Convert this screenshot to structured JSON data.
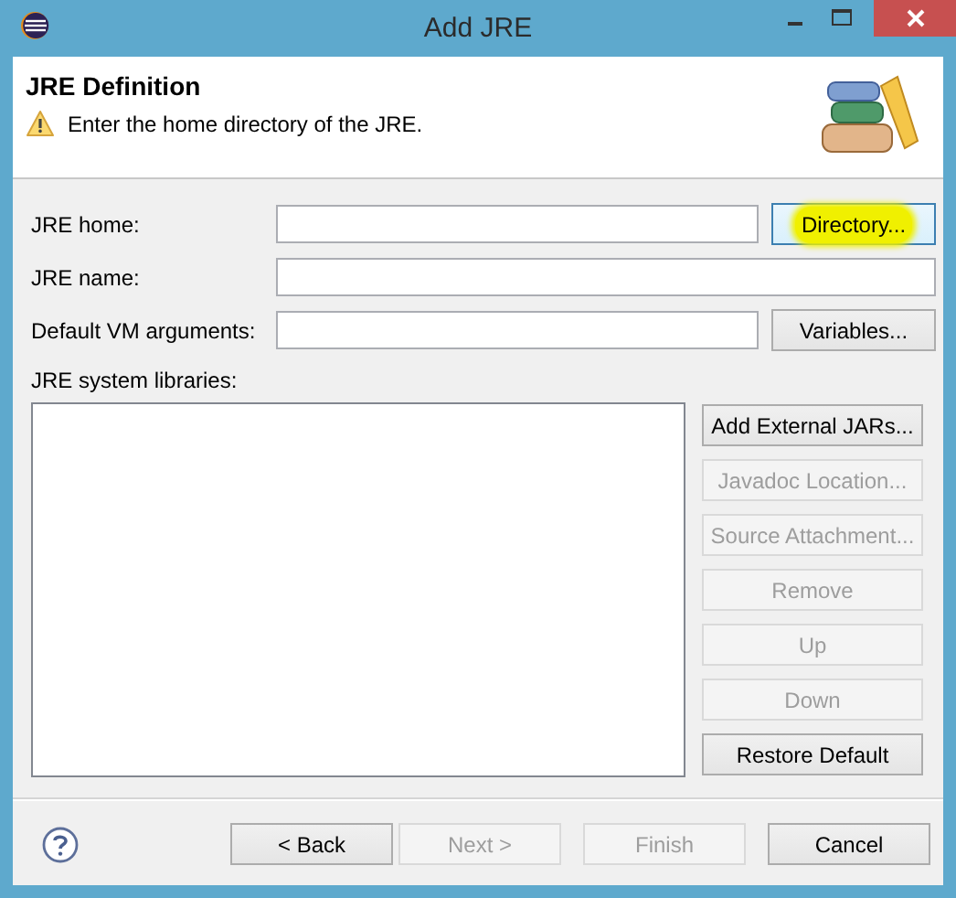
{
  "window": {
    "title": "Add JRE"
  },
  "header": {
    "title": "JRE Definition",
    "message": "Enter the home directory of the JRE."
  },
  "fields": [
    {
      "label": "JRE home:",
      "button": {
        "label": "Directory...",
        "disabled": false,
        "focused": true,
        "highlighted": true
      }
    },
    {
      "label": "JRE name:"
    },
    {
      "label": "Default VM arguments:",
      "button": {
        "label": "Variables...",
        "disabled": false,
        "focused": false,
        "highlighted": false
      }
    }
  ],
  "libraries": {
    "label": "JRE system libraries:",
    "buttons": [
      {
        "label": "Add External JARs...",
        "disabled": false
      },
      {
        "label": "Javadoc Location...",
        "disabled": true
      },
      {
        "label": "Source Attachment...",
        "disabled": true
      },
      {
        "label": "Remove",
        "disabled": true
      },
      {
        "label": "Up",
        "disabled": true
      },
      {
        "label": "Down",
        "disabled": true
      },
      {
        "label": "Restore Default",
        "disabled": false
      }
    ]
  },
  "footer": {
    "buttons": [
      {
        "label": "< Back",
        "disabled": false
      },
      {
        "label": "Next >",
        "disabled": true
      },
      {
        "label": "Finish",
        "disabled": true
      },
      {
        "label": "Cancel",
        "disabled": false
      }
    ]
  }
}
